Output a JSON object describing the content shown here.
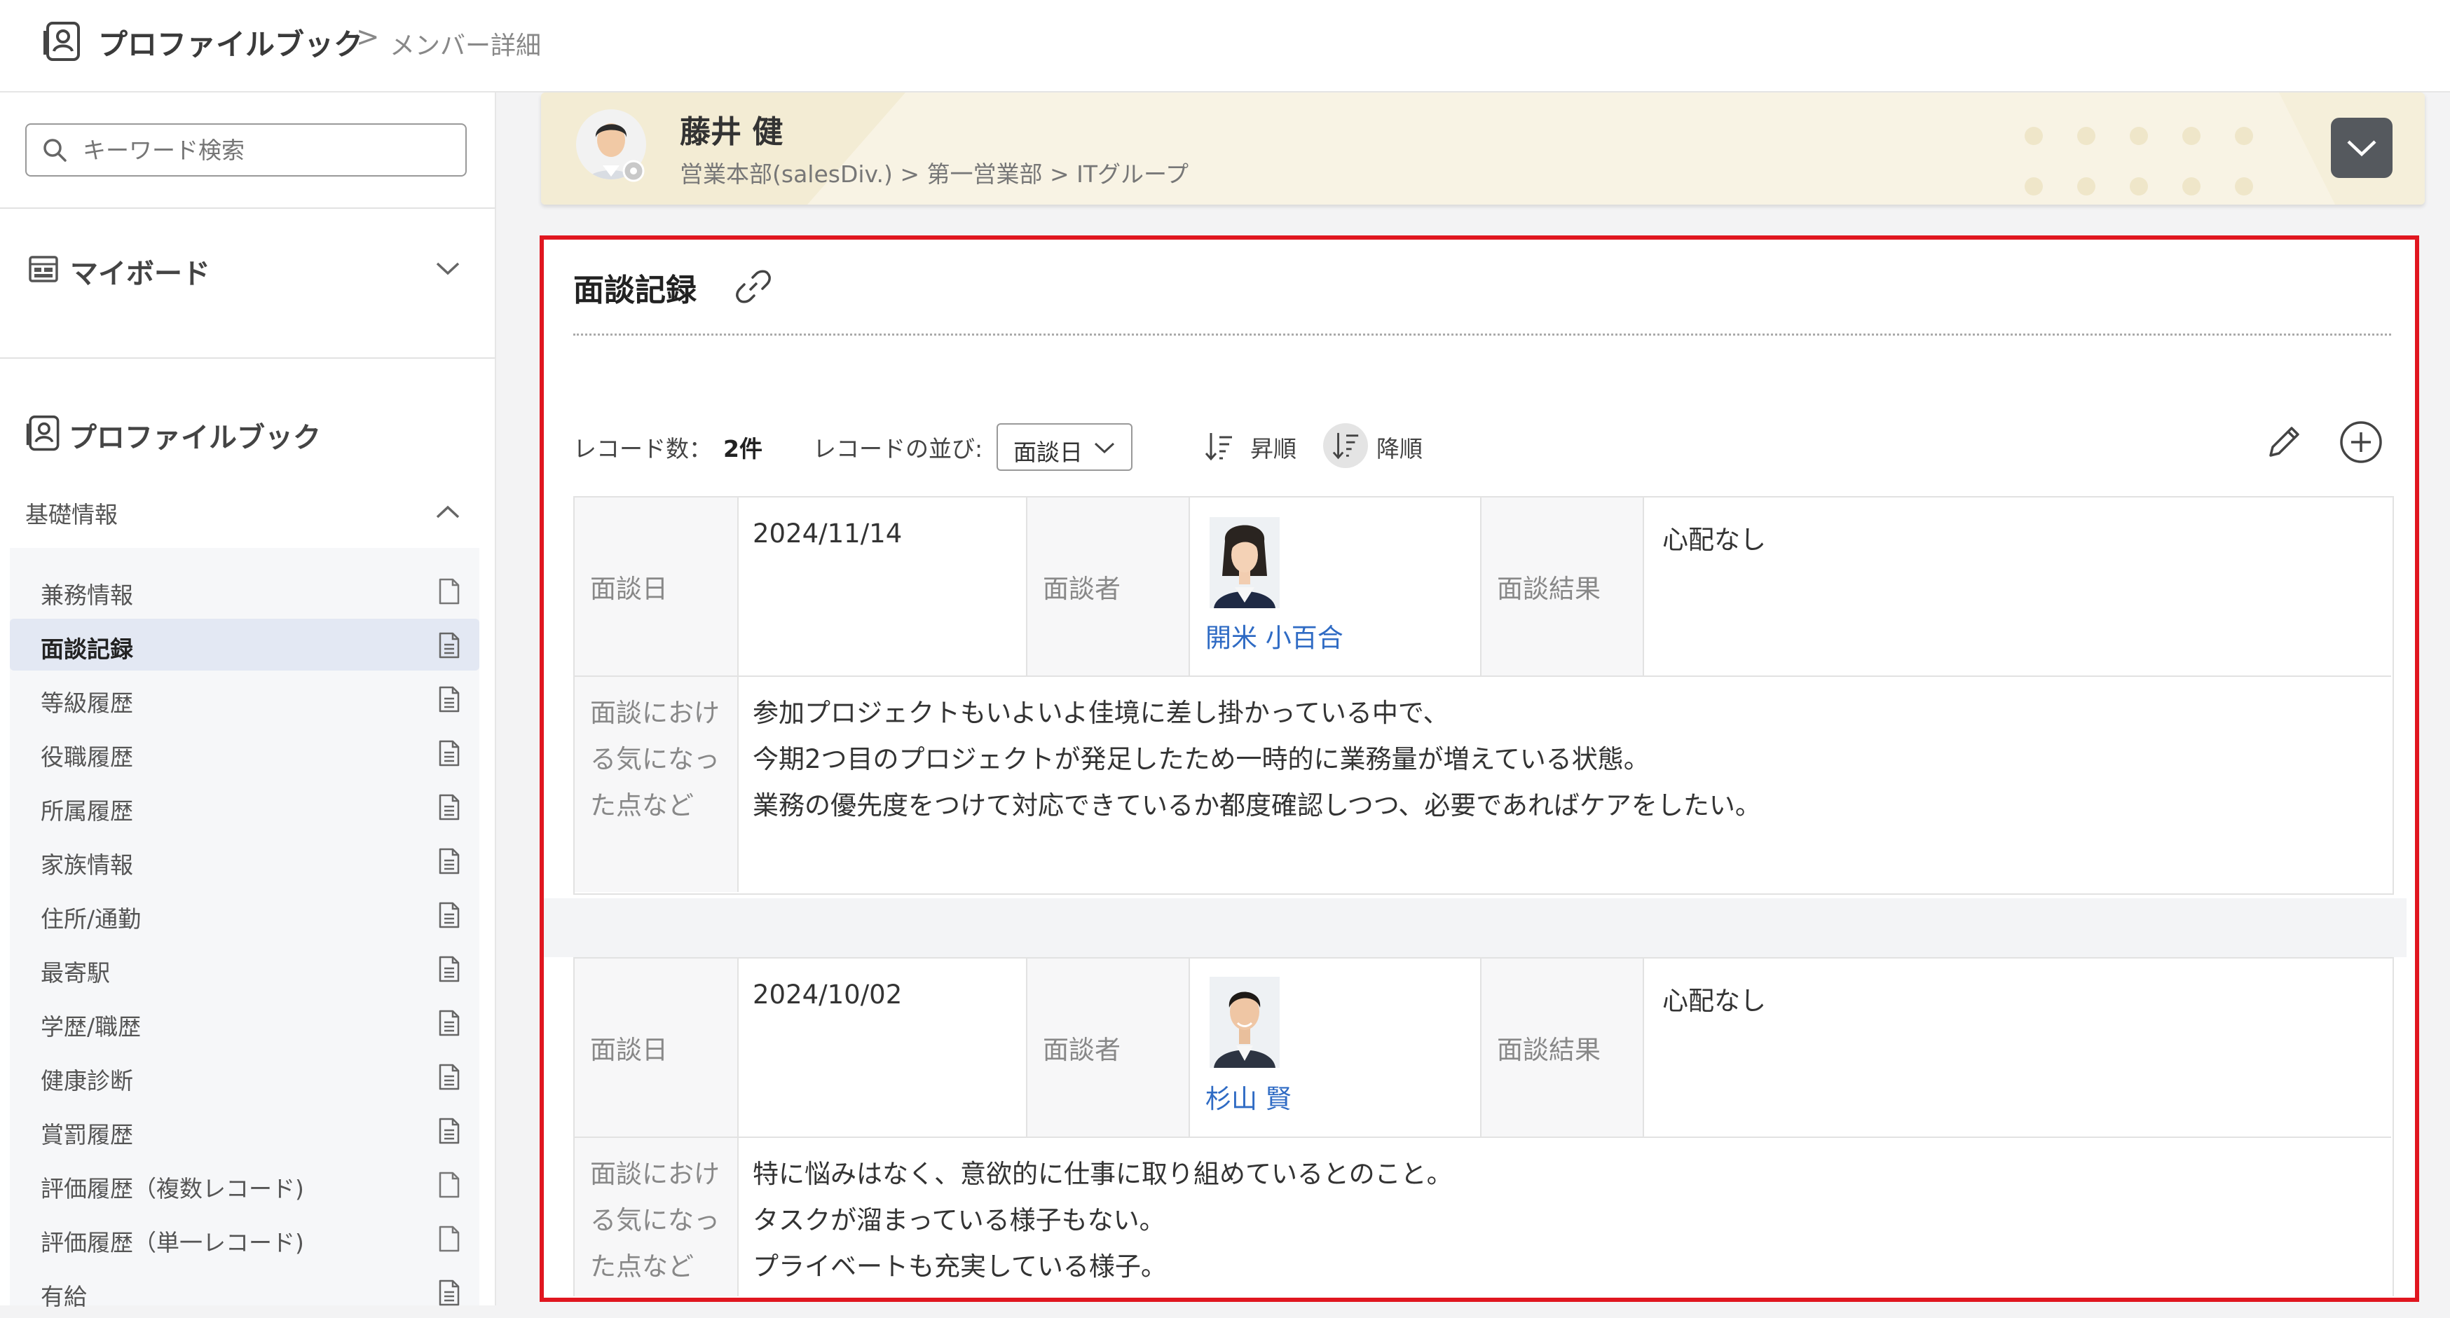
{
  "header": {
    "app_title": "プロファイルブック",
    "breadcrumb_sep": ">",
    "breadcrumb_current": "メンバー詳細"
  },
  "sidebar": {
    "search_placeholder": "キーワード検索",
    "myboard_label": "マイボード",
    "profilebook_label": "プロファイルブック",
    "basic_info_label": "基礎情報",
    "items": [
      {
        "label": "兼務情報",
        "icon": "blank-document-icon"
      },
      {
        "label": "面談記録",
        "icon": "document-icon",
        "active": true
      },
      {
        "label": "等級履歴",
        "icon": "document-icon"
      },
      {
        "label": "役職履歴",
        "icon": "document-icon"
      },
      {
        "label": "所属履歴",
        "icon": "document-icon"
      },
      {
        "label": "家族情報",
        "icon": "document-icon"
      },
      {
        "label": "住所/通勤",
        "icon": "document-icon"
      },
      {
        "label": "最寄駅",
        "icon": "document-icon"
      },
      {
        "label": "学歴/職歴",
        "icon": "document-icon"
      },
      {
        "label": "健康診断",
        "icon": "document-icon"
      },
      {
        "label": "賞罰履歴",
        "icon": "document-icon"
      },
      {
        "label": "評価履歴（複数レコード)",
        "icon": "blank-document-icon"
      },
      {
        "label": "評価履歴（単一レコード)",
        "icon": "blank-document-icon"
      },
      {
        "label": "有給",
        "icon": "document-icon"
      }
    ]
  },
  "employee": {
    "name": "藤井 健",
    "department": "営業本部(salesDiv.) > 第一営業部 > ITグループ"
  },
  "section": {
    "title": "面談記録",
    "record_count_label": "レコード数：",
    "record_count": "2件",
    "sort_label": "レコードの並び:",
    "sort_value": "面談日",
    "asc_label": "昇順",
    "desc_label": "降順"
  },
  "records": [
    {
      "date_label": "面談日",
      "date": "2024/11/14",
      "interviewer_label": "面談者",
      "interviewer": "開米 小百合",
      "result_label": "面談結果",
      "result": "心配なし",
      "notes_label": "面談における気になった点など",
      "notes": [
        "参加プロジェクトもいよいよ佳境に差し掛かっている中で、",
        "今期2つ目のプロジェクトが発足したため一時的に業務量が増えている状態。",
        "業務の優先度をつけて対応できているか都度確認しつつ、必要であればケアをしたい。"
      ]
    },
    {
      "date_label": "面談日",
      "date": "2024/10/02",
      "interviewer_label": "面談者",
      "interviewer": "杉山 賢",
      "result_label": "面談結果",
      "result": "心配なし",
      "notes_label": "面談における気になった点など",
      "notes": [
        "特に悩みはなく、意欲的に仕事に取り組めているとのこと。",
        "タスクが溜まっている様子もない。",
        "プライベートも充実している様子。"
      ]
    }
  ],
  "colors": {
    "highlight_border": "#e0161f",
    "link": "#2f6bc4",
    "active_nav_bg": "#e3e8f3",
    "banner_bg": "#f8f3e4"
  }
}
